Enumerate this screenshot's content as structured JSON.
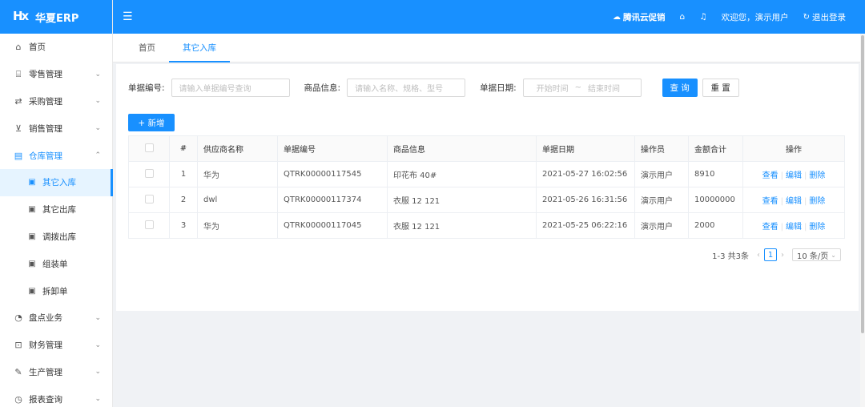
{
  "brand": {
    "name": "华夏ERP",
    "mark": "Hx"
  },
  "header": {
    "promo": "腾讯云促销",
    "welcome": "欢迎您，演示用户",
    "logout": "退出登录"
  },
  "sidebar": {
    "items": [
      {
        "label": "首页",
        "icon": "home-icon",
        "glyph": "⌂"
      },
      {
        "label": "零售管理",
        "icon": "shop-icon",
        "glyph": "⌸"
      },
      {
        "label": "采购管理",
        "icon": "swap-icon",
        "glyph": "⇄"
      },
      {
        "label": "销售管理",
        "icon": "cart-icon",
        "glyph": "⊻"
      },
      {
        "label": "仓库管理",
        "icon": "warehouse-icon",
        "glyph": "▤"
      },
      {
        "label": "其它入库",
        "icon": "doc-icon",
        "glyph": "▣"
      },
      {
        "label": "其它出库",
        "icon": "doc-icon",
        "glyph": "▣"
      },
      {
        "label": "调拨出库",
        "icon": "doc-icon",
        "glyph": "▣"
      },
      {
        "label": "组装单",
        "icon": "doc-icon",
        "glyph": "▣"
      },
      {
        "label": "拆卸单",
        "icon": "doc-icon",
        "glyph": "▣"
      },
      {
        "label": "盘点业务",
        "icon": "dashboard-icon",
        "glyph": "◔"
      },
      {
        "label": "财务管理",
        "icon": "finance-icon",
        "glyph": "⊡"
      },
      {
        "label": "生产管理",
        "icon": "tool-icon",
        "glyph": "✎"
      },
      {
        "label": "报表查询",
        "icon": "pie-chart-icon",
        "glyph": "◷"
      }
    ]
  },
  "tabs": [
    {
      "label": "首页"
    },
    {
      "label": "其它入库"
    }
  ],
  "filters": {
    "bill_no_label": "单据编号:",
    "bill_no_placeholder": "请输入单据编号查询",
    "goods_label": "商品信息:",
    "goods_placeholder": "请输入名称、规格、型号",
    "date_label": "单据日期:",
    "date_start": "开始时间",
    "date_sep": "~",
    "date_end": "结束时间",
    "query": "查 询",
    "reset": "重 置"
  },
  "add_button": "+ 新增",
  "table": {
    "columns": [
      "#",
      "供应商名称",
      "单据编号",
      "商品信息",
      "单据日期",
      "操作员",
      "金额合计",
      "操作"
    ],
    "rows": [
      {
        "idx": "1",
        "supplier": "华为",
        "bill_no": "QTRK00000117545",
        "goods": "印花布 40#",
        "date": "2021-05-27 16:02:56",
        "operator": "演示用户",
        "amount": "8910"
      },
      {
        "idx": "2",
        "supplier": "dwl",
        "bill_no": "QTRK00000117374",
        "goods": "衣服 12 121",
        "date": "2021-05-26 16:31:56",
        "operator": "演示用户",
        "amount": "10000000"
      },
      {
        "idx": "3",
        "supplier": "华为",
        "bill_no": "QTRK00000117045",
        "goods": "衣服 12 121",
        "date": "2021-05-25 06:22:16",
        "operator": "演示用户",
        "amount": "2000"
      }
    ],
    "actions": {
      "view": "查看",
      "edit": "编辑",
      "delete": "删除"
    }
  },
  "pager": {
    "summary": "1-3 共3条",
    "current": "1",
    "page_size": "10 条/页"
  },
  "colors": {
    "primary": "#1890ff",
    "active_bg": "#e6f4ff"
  }
}
